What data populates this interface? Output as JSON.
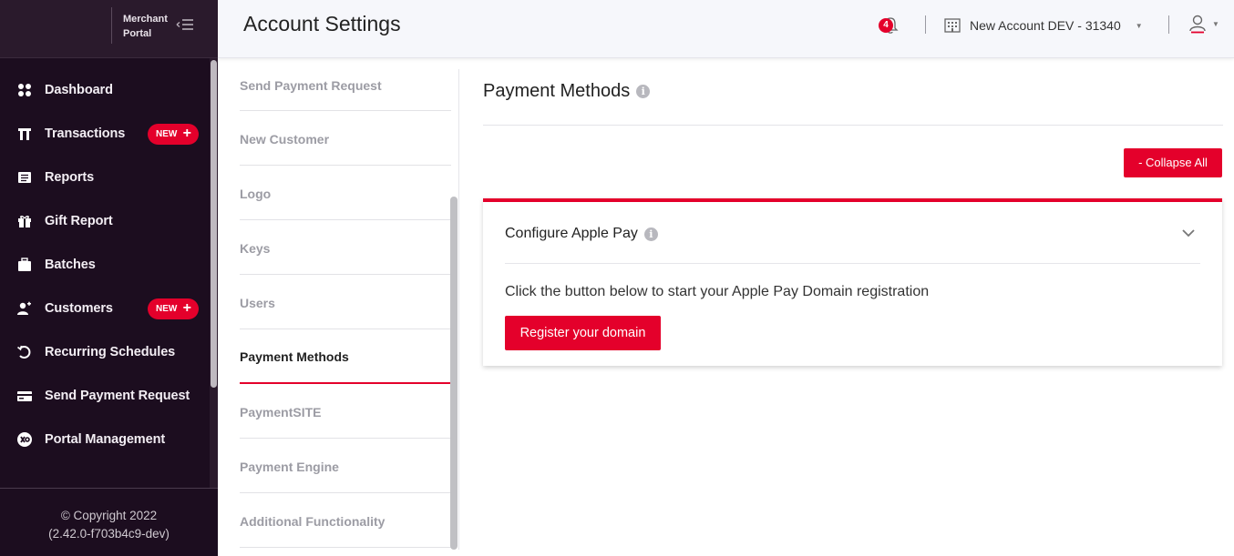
{
  "app": {
    "brand_line1": "Merchant",
    "brand_line2": "Portal"
  },
  "sidebar": {
    "items": [
      {
        "label": "Dashboard",
        "icon": "dashboard-icon"
      },
      {
        "label": "Transactions",
        "icon": "transactions-icon",
        "badge": "NEW"
      },
      {
        "label": "Reports",
        "icon": "reports-icon"
      },
      {
        "label": "Gift Report",
        "icon": "gift-icon"
      },
      {
        "label": "Batches",
        "icon": "batches-icon"
      },
      {
        "label": "Customers",
        "icon": "customers-icon",
        "badge": "NEW"
      },
      {
        "label": "Recurring Schedules",
        "icon": "recurring-icon"
      },
      {
        "label": "Send Payment Request",
        "icon": "card-icon"
      },
      {
        "label": "Portal Management",
        "icon": "portal-icon"
      }
    ],
    "footer_copyright": "© Copyright 2022",
    "footer_version": "(2.42.0-f703b4c9-dev)"
  },
  "header": {
    "title": "Account Settings",
    "notification_count": "4",
    "account_name": "New Account DEV - 31340"
  },
  "settings_menu": {
    "items": [
      {
        "label": "Send Payment Request"
      },
      {
        "label": "New Customer"
      },
      {
        "label": "Logo"
      },
      {
        "label": "Keys"
      },
      {
        "label": "Users"
      },
      {
        "label": "Payment Methods",
        "active": true
      },
      {
        "label": "PaymentSITE"
      },
      {
        "label": "Payment Engine"
      },
      {
        "label": "Additional Functionality"
      }
    ]
  },
  "main": {
    "section_title": "Payment Methods",
    "collapse_all_label": "- Collapse All",
    "card": {
      "title": "Configure Apple Pay",
      "description": "Click the button below to start your Apple Pay Domain registration",
      "button_label": "Register your domain"
    }
  },
  "colors": {
    "accent": "#e4002b",
    "sidebar_bg": "#1c0d1f"
  }
}
